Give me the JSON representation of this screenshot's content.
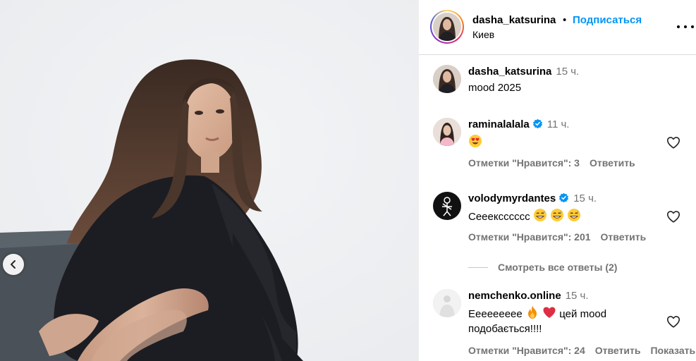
{
  "post": {
    "author": "dasha_katsurina",
    "follow_label": "Подписаться",
    "separator": "•",
    "location": "Киев",
    "caption_time": "15 ч.",
    "caption": "mood 2025"
  },
  "comments": [
    {
      "username": "raminalalala",
      "verified": true,
      "time": "11 ч.",
      "text": "",
      "emojis": [
        "heart-eyes"
      ],
      "likes_label": "Отметки \"Нравится\": 3",
      "reply_label": "Ответить"
    },
    {
      "username": "volodymyrdantes",
      "verified": true,
      "time": "15 ч.",
      "text": "Сееексссссс",
      "emojis": [
        "grin-sweat",
        "grin-sweat",
        "grin-sweat"
      ],
      "likes_label": "Отметки \"Нравится\": 201",
      "reply_label": "Ответить",
      "view_replies": "Смотреть все ответы (2)"
    },
    {
      "username": "nemchenko.online",
      "verified": false,
      "time": "15 ч.",
      "text_before": "Ееееееееe",
      "emojis": [
        "fire",
        "red-heart"
      ],
      "text_after": " цей mood подобається!!!!",
      "likes_label": "Отметки \"Нравится\": 24",
      "reply_label": "Ответить",
      "translate_label": "Показать перевод"
    }
  ],
  "icons": {
    "more": "more-horizontal-icon",
    "heart": "heart-outline-icon",
    "verified": "verified-badge-icon",
    "prev": "chevron-left-icon"
  },
  "colors": {
    "accent": "#0095f6",
    "verified": "#0095f6",
    "secondary_text": "#737373",
    "divider": "#dbdbdb"
  }
}
